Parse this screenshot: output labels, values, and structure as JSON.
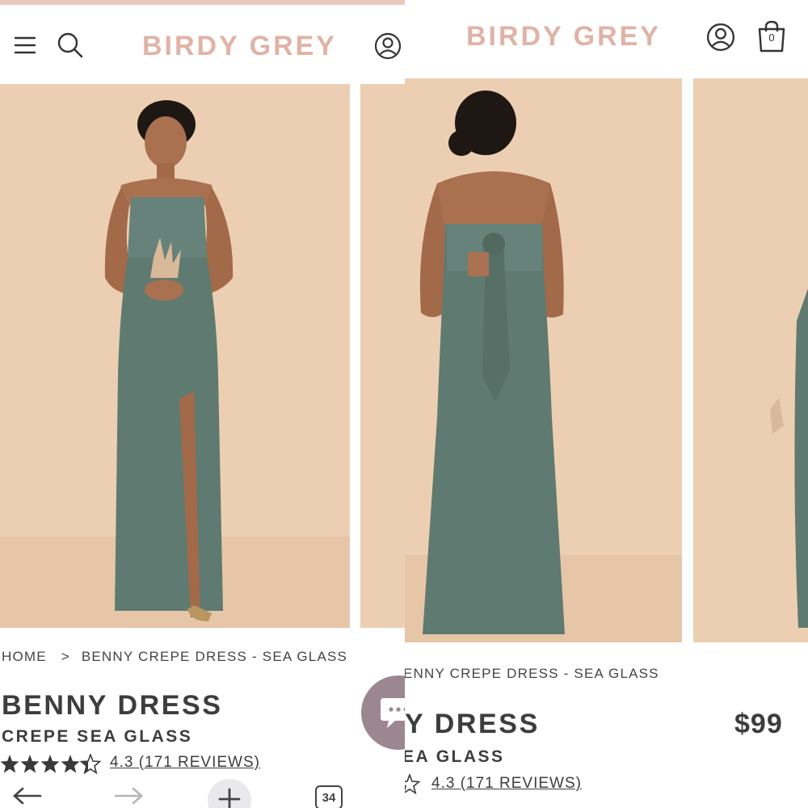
{
  "left": {
    "brand": "BIRDY GREY",
    "header": {
      "menu_icon": "hamburger-menu-icon",
      "search_icon": "search-icon",
      "account_icon": "user-account-icon"
    },
    "breadcrumb": {
      "home": "HOME",
      "separator": ">",
      "current": "BENNY CREPE DRESS - SEA GLASS"
    },
    "product": {
      "title": "BENNY DRESS",
      "subtitle": "CREPE SEA GLASS",
      "rating_value": 4.3,
      "rating_text": "4.3 (171 REVIEWS)"
    },
    "browser_nav": {
      "back_icon": "back-arrow-icon",
      "forward_icon": "forward-arrow-icon",
      "new_tab_icon": "plus-icon",
      "tab_count": "34"
    },
    "chat_icon": "chat-bubble-icon"
  },
  "right": {
    "brand": "BIRDY GREY",
    "header": {
      "account_icon": "user-account-icon",
      "cart_icon": "shopping-bag-icon",
      "cart_count": "0"
    },
    "breadcrumb": {
      "current": "ENNY CREPE DRESS - SEA GLASS"
    },
    "product": {
      "title": "Y DRESS",
      "subtitle": "EA GLASS",
      "price": "$99",
      "rating_text": "4.3 (171 REVIEWS)"
    }
  },
  "colors": {
    "brand": "#e0b3a6",
    "backdrop": "#eccfb2",
    "dress": "#5f7a70",
    "chat": "#9c8690",
    "text": "#3d3d3d"
  }
}
